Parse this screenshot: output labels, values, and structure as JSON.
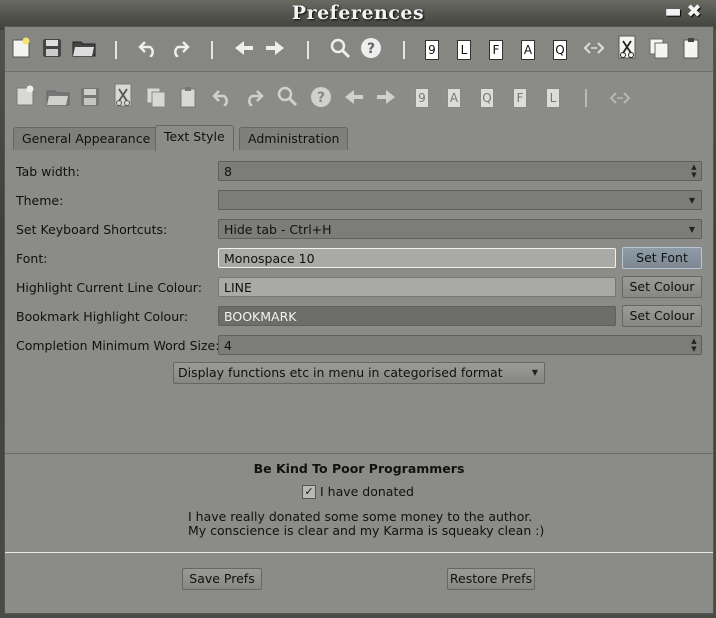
{
  "window": {
    "title": "Preferences",
    "minimize_icon": "minimize-icon",
    "close_icon": "close-icon"
  },
  "toolbar_main": {
    "icons": [
      "new-file-icon",
      "save-icon",
      "open-folder-icon",
      "undo-icon",
      "redo-icon",
      "back-arrow-icon",
      "forward-arrow-icon",
      "search-icon",
      "help-icon",
      "cut-icon",
      "copy-icon",
      "paste-icon",
      "tag-icon"
    ],
    "box_buttons": [
      "9",
      "L",
      "F",
      "A",
      "Q"
    ]
  },
  "toolbar_config": {
    "box_buttons": [
      "9",
      "A",
      "Q",
      "F",
      "L"
    ]
  },
  "tabs": [
    {
      "label": "General Appearance",
      "active": false
    },
    {
      "label": "Text Style",
      "active": true
    },
    {
      "label": "Administration",
      "active": false
    }
  ],
  "settings": {
    "tab_width": {
      "label": "Tab width:",
      "value": "8"
    },
    "theme": {
      "label": "Theme:",
      "value": ""
    },
    "shortcuts": {
      "label": "Set Keyboard Shortcuts:",
      "value": "Hide tab - Ctrl+H"
    },
    "font": {
      "label": "Font:",
      "value": "Monospace 10",
      "button": "Set Font"
    },
    "highlight_line": {
      "label": "Highlight Current Line Colour:",
      "value": "LINE",
      "button": "Set Colour"
    },
    "bookmark": {
      "label": "Bookmark Highlight Colour:",
      "value": "BOOKMARK",
      "button": "Set Colour"
    },
    "completion": {
      "label": "Completion Minimum Word Size:",
      "value": "4"
    },
    "functions_menu": {
      "value": "Display functions etc in menu in categorised format"
    }
  },
  "donate": {
    "title": "Be Kind To Poor Programmers",
    "checkbox_label": "I have donated",
    "checked": true,
    "line1": "I have really donated some some money to the author.",
    "line2": "My conscience is clear and my Karma is squeaky clean :)"
  },
  "footer": {
    "save": "Save Prefs",
    "restore": "Restore Prefs"
  },
  "colors": {
    "background": "#8b8c88",
    "focus_button": "#8e9aa6"
  }
}
